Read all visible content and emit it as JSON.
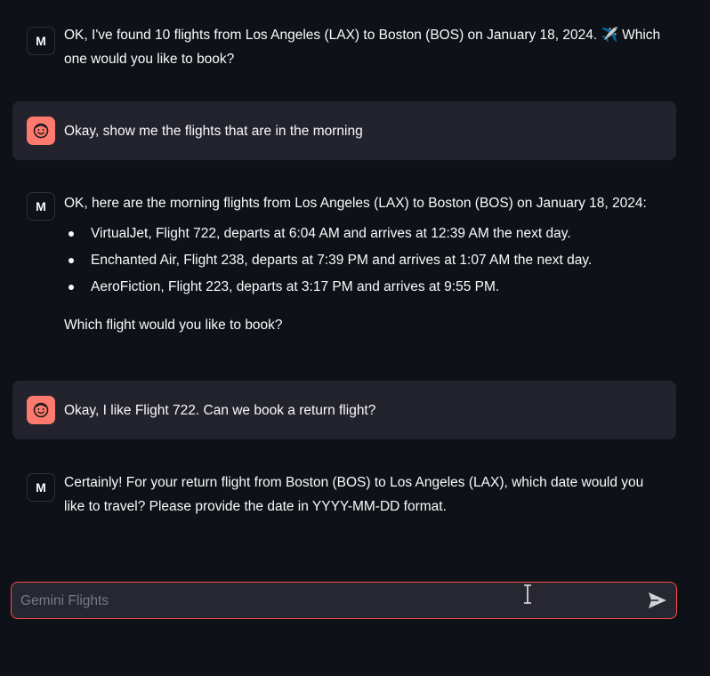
{
  "messages": [
    {
      "role": "assistant",
      "avatar_label": "M",
      "text": "OK, I've found 10 flights from Los Angeles (LAX) to Boston (BOS) on January 18, 2024. ✈️ Which one would you like to book?"
    },
    {
      "role": "user",
      "avatar_icon": "smiley-face-icon",
      "text": "Okay, show me the flights that are in the morning"
    },
    {
      "role": "assistant",
      "avatar_label": "M",
      "intro": "OK, here are the morning flights from Los Angeles (LAX) to Boston (BOS) on January 18, 2024:",
      "flights": [
        "VirtualJet, Flight 722, departs at 6:04 AM and arrives at 12:39 AM the next day.",
        "Enchanted Air, Flight 238, departs at 7:39 PM and arrives at 1:07 AM the next day.",
        "AeroFiction, Flight 223, departs at 3:17 PM and arrives at 9:55 PM."
      ],
      "outro": "Which flight would you like to book?"
    },
    {
      "role": "user",
      "avatar_icon": "smiley-face-icon",
      "text": "Okay, I like Flight 722. Can we book a return flight?"
    },
    {
      "role": "assistant",
      "avatar_label": "M",
      "text": "Certainly! For your return flight from Boston (BOS) to Los Angeles (LAX), which date would you like to travel? Please provide the date in YYYY-MM-DD format."
    }
  ],
  "chat_input": {
    "placeholder": "Gemini Flights",
    "value": "",
    "send_icon": "send-icon"
  },
  "colors": {
    "background": "#0e1117",
    "user_message_bg": "#262730",
    "user_avatar": "#ff7a6e",
    "input_border": "#ff4b4b",
    "text": "#fafafa"
  }
}
